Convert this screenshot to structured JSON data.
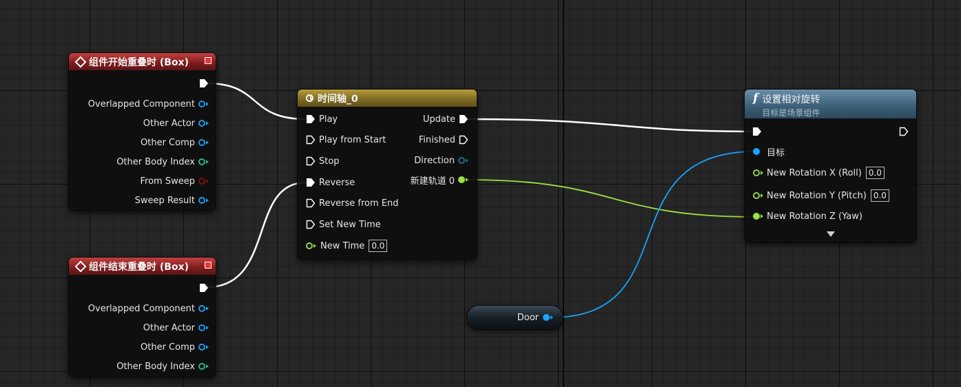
{
  "colors": {
    "exec_wire": "#ffffff",
    "object_pin": "#1a9be8",
    "float_pin": "#9be045",
    "int_pin": "#27b58b",
    "bool_pin": "#7a1111",
    "event_header": "#7c1d1d",
    "timeline_header": "#7b6822",
    "function_header": "#3b5e76"
  },
  "nodes": {
    "begin_overlap": {
      "title": "组件开始重叠时 (Box)",
      "pins": [
        {
          "label": "Overlapped Component",
          "type": "object"
        },
        {
          "label": "Other Actor",
          "type": "object"
        },
        {
          "label": "Other Comp",
          "type": "object"
        },
        {
          "label": "Other Body Index",
          "type": "int"
        },
        {
          "label": "From Sweep",
          "type": "bool"
        },
        {
          "label": "Sweep Result",
          "type": "object"
        }
      ]
    },
    "end_overlap": {
      "title": "组件结束重叠时 (Box)",
      "pins": [
        {
          "label": "Overlapped Component",
          "type": "object"
        },
        {
          "label": "Other Actor",
          "type": "object"
        },
        {
          "label": "Other Comp",
          "type": "object"
        },
        {
          "label": "Other Body Index",
          "type": "int"
        }
      ]
    },
    "timeline": {
      "title": "时间轴_0",
      "inputs": [
        "Play",
        "Play from Start",
        "Stop",
        "Reverse",
        "Reverse from End",
        "Set New Time"
      ],
      "new_time_label": "New Time",
      "new_time_value": "0.0",
      "outputs": [
        "Update",
        "Finished",
        "Direction",
        "新建轨道 0"
      ]
    },
    "set_rotation": {
      "title": "设置相对旋转",
      "subtitle": "目标是场景组件",
      "target_label": "目标",
      "rot_x_label": "New Rotation X (Roll)",
      "rot_x_value": "0.0",
      "rot_y_label": "New Rotation Y (Pitch)",
      "rot_y_value": "0.0",
      "rot_z_label": "New Rotation Z (Yaw)"
    },
    "door_var": {
      "label": "Door"
    }
  }
}
